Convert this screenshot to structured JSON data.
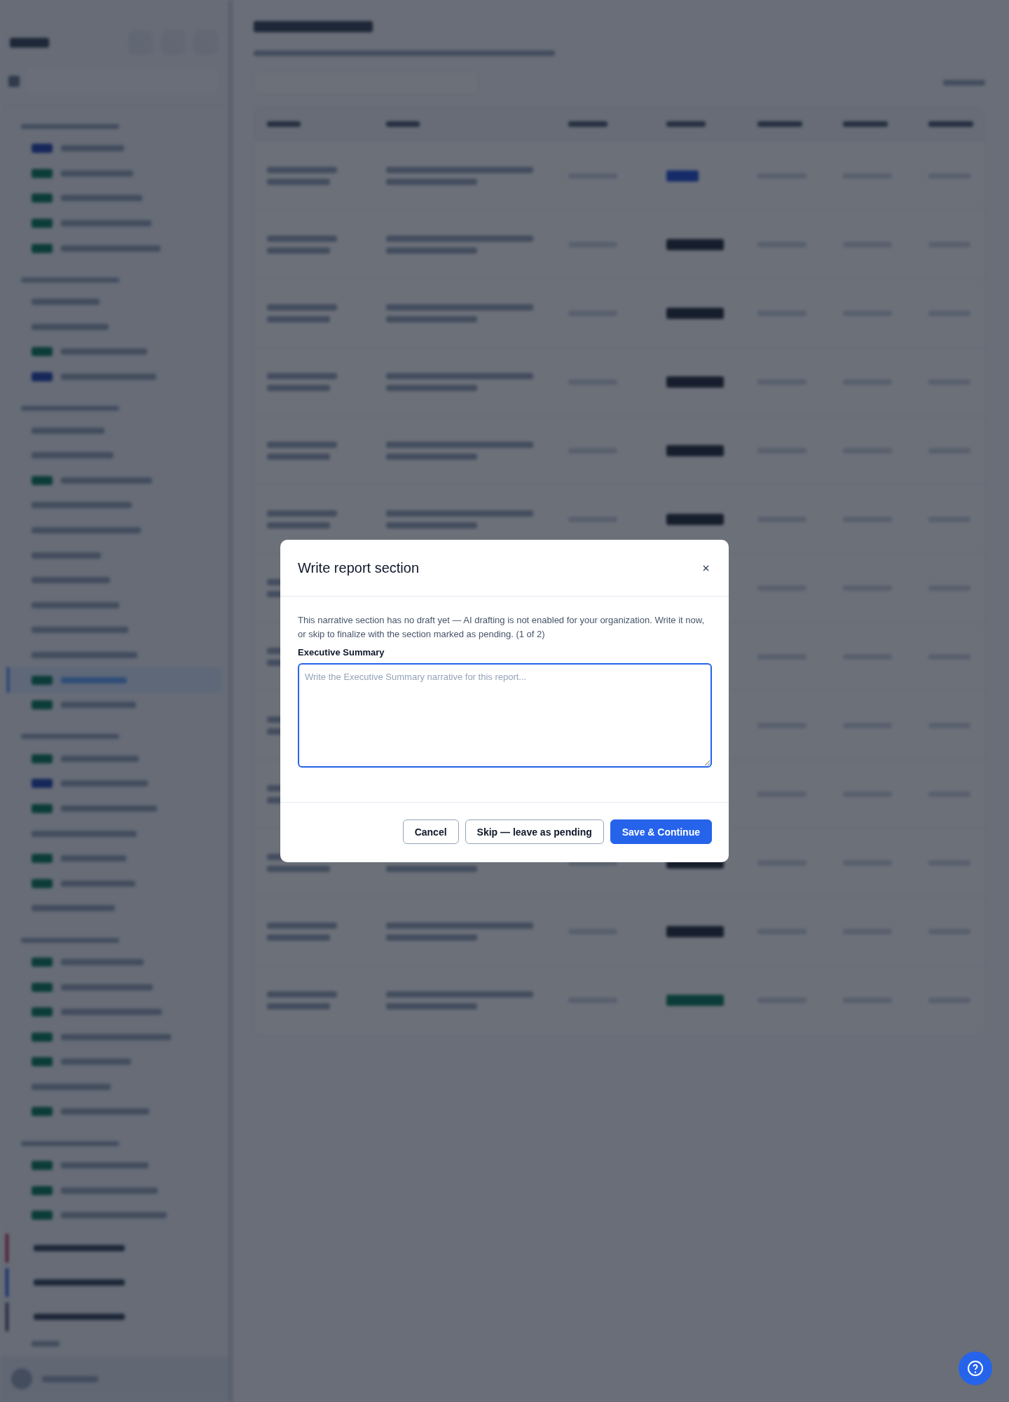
{
  "dialog": {
    "title": "Write report section",
    "message": "This narrative section has no draft yet — AI drafting is not enabled for your organization. Write it now, or skip to finalize with the section marked as pending. (1 of 2)",
    "field_label": "Executive Summary",
    "field_placeholder": "Write the Executive Summary narrative for this report...",
    "buttons": [
      {
        "label": "Cancel",
        "kind": "secondary"
      },
      {
        "label": "Skip — leave as pending",
        "kind": "secondary"
      },
      {
        "label": "Save & Continue",
        "kind": "primary"
      }
    ]
  }
}
